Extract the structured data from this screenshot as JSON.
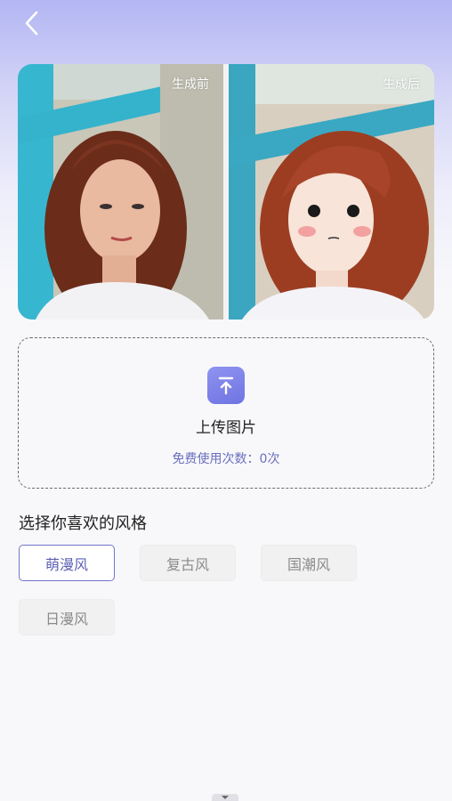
{
  "header": {
    "back_icon": "chevron-left-icon"
  },
  "compare": {
    "before_label": "生成前",
    "after_label": "生成后"
  },
  "upload": {
    "icon": "upload-arrow-icon",
    "label": "上传图片",
    "free_count": "免费使用次数：0次"
  },
  "styles": {
    "title": "选择你喜欢的风格",
    "options": [
      {
        "label": "萌漫风",
        "selected": true
      },
      {
        "label": "复古风",
        "selected": false
      },
      {
        "label": "国潮风",
        "selected": false
      },
      {
        "label": "日漫风",
        "selected": false
      }
    ]
  },
  "colors": {
    "accent": "#7275c9",
    "header_gradient_top": "#b3b6f4",
    "upload_icon": "#7b80ea"
  }
}
